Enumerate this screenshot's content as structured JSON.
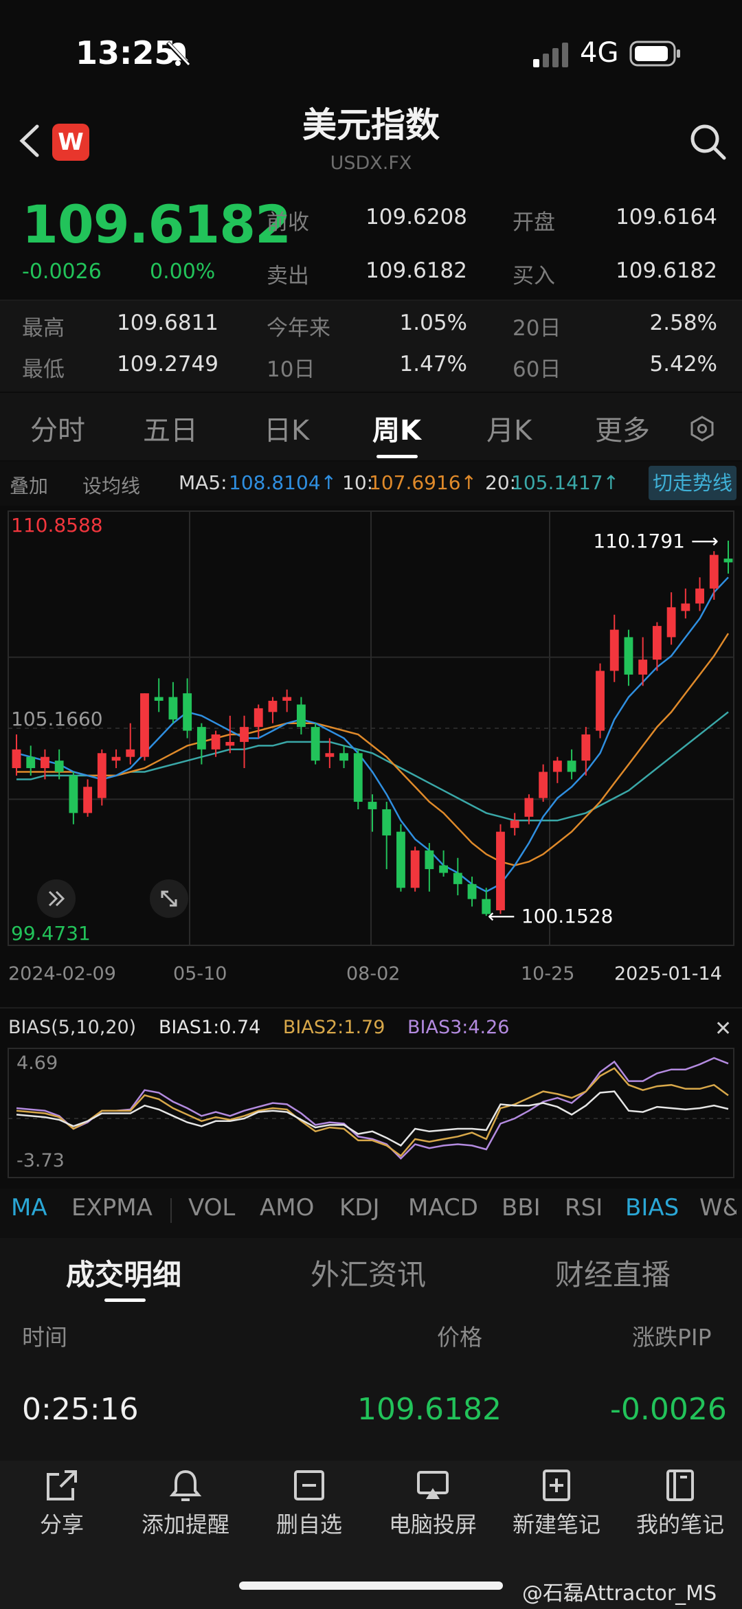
{
  "status_bar": {
    "time": "13:25",
    "network": "4G"
  },
  "header": {
    "title": "美元指数",
    "symbol": "USDX.FX",
    "logo_letter": "W"
  },
  "quote": {
    "price": "109.6182",
    "change": "-0.0026",
    "change_pct": "0.00%",
    "prev_close_label": "前收",
    "prev_close": "109.6208",
    "open_label": "开盘",
    "open": "109.6164",
    "ask_label": "卖出",
    "ask": "109.6182",
    "bid_label": "买入",
    "bid": "109.6182",
    "high_label": "最高",
    "high": "109.6811",
    "low_label": "最低",
    "low": "109.2749",
    "ytd_label": "今年来",
    "ytd": "1.05%",
    "d10_label": "10日",
    "d10": "1.47%",
    "d20_label": "20日",
    "d20": "2.58%",
    "d60_label": "60日",
    "d60": "5.42%"
  },
  "period_tabs": [
    "分时",
    "五日",
    "日K",
    "周K",
    "月K",
    "更多"
  ],
  "active_period": "周K",
  "ma_legend": {
    "overlay": "叠加",
    "set_ma": "设均线",
    "ma5_label": "MA5:",
    "ma5_value": "108.8104↑",
    "ma10_label": "10:",
    "ma10_value": "107.6916↑",
    "ma20_label": "20:",
    "ma20_value": "105.1417↑",
    "trend_button": "切走势线"
  },
  "colors": {
    "up": "#f2363d",
    "down": "#22c35a",
    "ma5": "#2f8fe0",
    "ma10": "#e08a2a",
    "ma20": "#3aa8a8",
    "bias1": "#e6e6e6",
    "bias2": "#d8a84a",
    "bias3": "#b48be0"
  },
  "chart_data": {
    "type": "candlestick",
    "interval": "weekly",
    "y_top_label": "110.8588",
    "y_mid_label": "105.1660",
    "y_bottom_label": "99.4731",
    "ylim": [
      99.4731,
      110.8588
    ],
    "max_marker": "110.1791",
    "min_marker": "100.1528",
    "x_ticks": [
      "2024-02-09",
      "05-10",
      "08-02",
      "10-25",
      "2025-01-14"
    ],
    "candles": [
      {
        "o": 104.1,
        "c": 104.6,
        "h": 105.0,
        "l": 103.9
      },
      {
        "o": 104.4,
        "c": 104.1,
        "h": 104.7,
        "l": 103.9
      },
      {
        "o": 104.1,
        "c": 104.4,
        "h": 104.6,
        "l": 103.8
      },
      {
        "o": 104.3,
        "c": 104.0,
        "h": 104.6,
        "l": 103.8
      },
      {
        "o": 103.9,
        "c": 102.9,
        "h": 104.0,
        "l": 102.6
      },
      {
        "o": 102.9,
        "c": 103.6,
        "h": 103.8,
        "l": 102.8
      },
      {
        "o": 103.3,
        "c": 104.5,
        "h": 104.6,
        "l": 103.1
      },
      {
        "o": 104.3,
        "c": 104.4,
        "h": 104.6,
        "l": 104.1
      },
      {
        "o": 104.4,
        "c": 104.6,
        "h": 105.3,
        "l": 104.2
      },
      {
        "o": 104.4,
        "c": 106.1,
        "h": 106.1,
        "l": 104.3
      },
      {
        "o": 106.0,
        "c": 105.9,
        "h": 106.5,
        "l": 105.6
      },
      {
        "o": 106.0,
        "c": 105.4,
        "h": 106.4,
        "l": 105.3
      },
      {
        "o": 106.1,
        "c": 105.1,
        "h": 106.5,
        "l": 104.9
      },
      {
        "o": 105.2,
        "c": 104.6,
        "h": 105.3,
        "l": 104.2
      },
      {
        "o": 104.6,
        "c": 105.0,
        "h": 105.1,
        "l": 104.4
      },
      {
        "o": 104.7,
        "c": 104.8,
        "h": 105.5,
        "l": 104.5
      },
      {
        "o": 104.8,
        "c": 105.2,
        "h": 105.5,
        "l": 104.1
      },
      {
        "o": 105.2,
        "c": 105.7,
        "h": 105.8,
        "l": 104.9
      },
      {
        "o": 105.6,
        "c": 105.9,
        "h": 106.0,
        "l": 105.3
      },
      {
        "o": 105.9,
        "c": 106.0,
        "h": 106.2,
        "l": 105.6
      },
      {
        "o": 105.8,
        "c": 105.2,
        "h": 106.0,
        "l": 105.0
      },
      {
        "o": 105.2,
        "c": 104.3,
        "h": 105.3,
        "l": 104.2
      },
      {
        "o": 104.4,
        "c": 104.5,
        "h": 104.9,
        "l": 104.1
      },
      {
        "o": 104.5,
        "c": 104.3,
        "h": 104.7,
        "l": 104.1
      },
      {
        "o": 104.5,
        "c": 103.2,
        "h": 104.6,
        "l": 103.0
      },
      {
        "o": 103.2,
        "c": 103.0,
        "h": 103.4,
        "l": 102.4
      },
      {
        "o": 103.0,
        "c": 102.3,
        "h": 103.2,
        "l": 101.4
      },
      {
        "o": 102.4,
        "c": 100.9,
        "h": 102.6,
        "l": 100.8
      },
      {
        "o": 100.9,
        "c": 101.9,
        "h": 102.0,
        "l": 100.8
      },
      {
        "o": 101.9,
        "c": 101.4,
        "h": 102.1,
        "l": 100.8
      },
      {
        "o": 101.5,
        "c": 101.3,
        "h": 101.9,
        "l": 101.2
      },
      {
        "o": 101.3,
        "c": 101.0,
        "h": 101.7,
        "l": 100.7
      },
      {
        "o": 101.0,
        "c": 100.6,
        "h": 101.2,
        "l": 100.4
      },
      {
        "o": 100.6,
        "c": 100.2,
        "h": 100.9,
        "l": 100.15
      },
      {
        "o": 100.3,
        "c": 102.4,
        "h": 102.6,
        "l": 100.2
      },
      {
        "o": 102.5,
        "c": 102.7,
        "h": 102.9,
        "l": 102.3
      },
      {
        "o": 102.8,
        "c": 103.3,
        "h": 103.4,
        "l": 102.6
      },
      {
        "o": 103.3,
        "c": 104.0,
        "h": 104.2,
        "l": 103.2
      },
      {
        "o": 104.0,
        "c": 104.3,
        "h": 104.4,
        "l": 103.7
      },
      {
        "o": 104.3,
        "c": 104.0,
        "h": 104.6,
        "l": 103.8
      },
      {
        "o": 104.3,
        "c": 105.0,
        "h": 105.2,
        "l": 103.9
      },
      {
        "o": 105.1,
        "c": 106.7,
        "h": 106.9,
        "l": 104.9
      },
      {
        "o": 106.7,
        "c": 107.8,
        "h": 108.2,
        "l": 106.4
      },
      {
        "o": 107.6,
        "c": 106.6,
        "h": 107.8,
        "l": 106.3
      },
      {
        "o": 106.6,
        "c": 107.0,
        "h": 107.6,
        "l": 106.3
      },
      {
        "o": 107.0,
        "c": 107.9,
        "h": 108.0,
        "l": 106.7
      },
      {
        "o": 107.6,
        "c": 108.4,
        "h": 108.8,
        "l": 107.4
      },
      {
        "o": 108.3,
        "c": 108.5,
        "h": 108.9,
        "l": 108.1
      },
      {
        "o": 108.5,
        "c": 108.9,
        "h": 109.2,
        "l": 108.3
      },
      {
        "o": 108.9,
        "c": 109.8,
        "h": 109.9,
        "l": 108.6
      },
      {
        "o": 109.7,
        "c": 109.6,
        "h": 110.18,
        "l": 109.3
      }
    ],
    "ma5": [
      104.5,
      104.4,
      104.3,
      104.2,
      104.0,
      103.9,
      103.8,
      103.9,
      104.1,
      104.5,
      104.9,
      105.3,
      105.6,
      105.5,
      105.3,
      105.1,
      104.9,
      104.9,
      105.1,
      105.3,
      105.4,
      105.3,
      105.1,
      104.9,
      104.5,
      104.0,
      103.4,
      102.7,
      102.2,
      101.9,
      101.5,
      101.3,
      101.0,
      100.8,
      101.0,
      101.5,
      102.1,
      102.8,
      103.3,
      103.6,
      104.0,
      104.5,
      105.4,
      106.0,
      106.4,
      106.8,
      107.1,
      107.6,
      108.1,
      108.8,
      109.2
    ],
    "ma10": [
      104.0,
      104.0,
      104.0,
      104.0,
      104.0,
      103.9,
      103.9,
      103.9,
      104.0,
      104.1,
      104.3,
      104.5,
      104.7,
      104.8,
      104.9,
      105.0,
      105.0,
      105.1,
      105.2,
      105.3,
      105.3,
      105.3,
      105.2,
      105.1,
      105.0,
      104.7,
      104.4,
      104.0,
      103.6,
      103.2,
      102.9,
      102.5,
      102.1,
      101.8,
      101.6,
      101.5,
      101.6,
      101.8,
      102.1,
      102.4,
      102.8,
      103.2,
      103.7,
      104.2,
      104.7,
      105.2,
      105.6,
      106.1,
      106.6,
      107.1,
      107.7
    ],
    "ma20": [
      103.8,
      103.8,
      103.9,
      103.9,
      103.9,
      103.9,
      103.9,
      103.9,
      104.0,
      104.0,
      104.1,
      104.2,
      104.3,
      104.4,
      104.5,
      104.6,
      104.6,
      104.7,
      104.7,
      104.8,
      104.8,
      104.8,
      104.8,
      104.7,
      104.6,
      104.5,
      104.3,
      104.1,
      103.9,
      103.7,
      103.5,
      103.3,
      103.1,
      102.9,
      102.8,
      102.7,
      102.7,
      102.7,
      102.7,
      102.8,
      102.9,
      103.1,
      103.3,
      103.5,
      103.8,
      104.1,
      104.4,
      104.7,
      105.0,
      105.3,
      105.6
    ]
  },
  "bias": {
    "title": "BIAS(5,10,20)",
    "bias1_label": "BIAS1:0.74",
    "bias2_label": "BIAS2:1.79",
    "bias3_label": "BIAS3:4.26",
    "top_label": "4.69",
    "bottom_label": "-3.73",
    "ylim": [
      -3.73,
      4.69
    ],
    "bias1": [
      0.3,
      0.2,
      0.1,
      -0.1,
      -0.6,
      -0.2,
      0.4,
      0.4,
      0.4,
      1.0,
      0.7,
      0.2,
      -0.3,
      -0.6,
      -0.2,
      -0.2,
      0.0,
      0.5,
      0.6,
      0.5,
      -0.1,
      -0.7,
      -0.5,
      -0.5,
      -1.2,
      -1.0,
      -1.5,
      -2.1,
      -0.8,
      -1.0,
      -0.9,
      -0.8,
      -0.8,
      -0.9,
      1.1,
      1.0,
      1.0,
      1.2,
      0.9,
      0.3,
      1.0,
      2.0,
      2.1,
      0.6,
      0.5,
      0.9,
      0.8,
      0.7,
      0.8,
      1.0,
      0.74
    ],
    "bias2": [
      0.6,
      0.5,
      0.4,
      0.1,
      -0.8,
      -0.2,
      0.6,
      0.6,
      0.6,
      1.8,
      1.5,
      0.8,
      0.3,
      -0.2,
      0.1,
      -0.1,
      0.2,
      0.6,
      0.8,
      0.7,
      -0.2,
      -1.0,
      -0.7,
      -0.8,
      -1.7,
      -1.7,
      -2.1,
      -2.9,
      -1.6,
      -1.8,
      -1.6,
      -1.4,
      -1.1,
      -1.6,
      0.8,
      1.1,
      1.6,
      2.1,
      1.9,
      1.6,
      2.1,
      3.3,
      3.9,
      2.6,
      2.2,
      2.5,
      2.6,
      2.3,
      2.3,
      2.6,
      1.79
    ],
    "bias3": [
      0.8,
      0.7,
      0.6,
      0.2,
      -0.8,
      -0.3,
      0.6,
      0.6,
      0.7,
      2.2,
      2.0,
      1.3,
      0.8,
      0.2,
      0.5,
      0.2,
      0.6,
      0.9,
      1.2,
      1.1,
      0.4,
      -0.5,
      -0.3,
      -0.4,
      -1.4,
      -1.6,
      -2.0,
      -3.1,
      -2.0,
      -2.3,
      -2.1,
      -2.0,
      -2.1,
      -2.4,
      -0.4,
      0.0,
      0.6,
      1.3,
      1.6,
      1.2,
      2.1,
      3.6,
      4.4,
      2.9,
      2.9,
      3.5,
      3.8,
      3.8,
      4.2,
      4.69,
      4.26
    ]
  },
  "indicator_tabs": [
    "MA",
    "EXPMA",
    "VOL",
    "AMO",
    "KDJ",
    "MACD",
    "BBI",
    "RSI",
    "BIAS",
    "W&"
  ],
  "detail_tabs": [
    "成交明细",
    "外汇资讯",
    "财经直播"
  ],
  "trades": {
    "headers": [
      "时间",
      "价格",
      "涨跌PIP"
    ],
    "rows": [
      {
        "time": "0:25:16",
        "price": "109.6182",
        "change": "-0.0026"
      }
    ]
  },
  "bottom_bar": [
    "分享",
    "添加提醒",
    "删自选",
    "电脑投屏",
    "新建笔记",
    "我的笔记"
  ],
  "watermark": "@石磊Attractor_MS"
}
